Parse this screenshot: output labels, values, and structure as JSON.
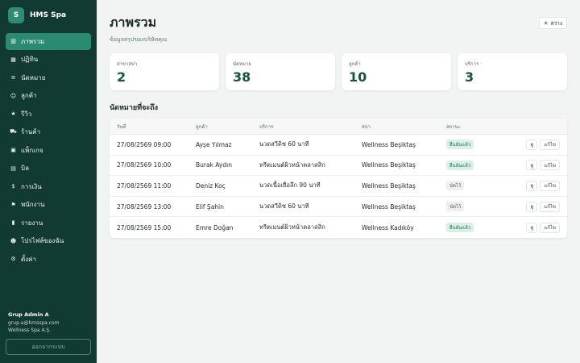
{
  "brand": {
    "logo_letter": "S",
    "name": "HMS Spa"
  },
  "sidebar": {
    "items": [
      {
        "icon": "▥",
        "label": "ภาพรวม",
        "active": true
      },
      {
        "icon": "▦",
        "label": "ปฏิทิน"
      },
      {
        "icon": "≡",
        "label": "นัดหมาย"
      },
      {
        "icon": "☺",
        "label": "ลูกค้า"
      },
      {
        "icon": "★",
        "label": "รีวิว"
      },
      {
        "icon": "⛟",
        "label": "ร้านค้า"
      },
      {
        "icon": "▣",
        "label": "แพ็กเกจ"
      },
      {
        "icon": "▤",
        "label": "บิล"
      },
      {
        "icon": "$",
        "label": "การเงิน"
      },
      {
        "icon": "⚑",
        "label": "พนักงาน"
      },
      {
        "icon": "▮",
        "label": "รายงาน"
      },
      {
        "icon": "☻",
        "label": "โปรไฟล์ของฉัน"
      },
      {
        "icon": "⚙",
        "label": "ตั้งค่า"
      }
    ],
    "user": {
      "name": "Grup Admin A",
      "email": "grup.a@hmsspa.com",
      "company": "Wellness Spa A.Ş."
    },
    "logout_label": "ออกจากระบบ"
  },
  "header": {
    "title": "ภาพรวม",
    "subtitle": "ข้อมูลสรุปของบริษัทคุณ",
    "theme_icon": "☀",
    "theme_label": "สว่าง"
  },
  "stats": [
    {
      "label": "สาขาสปา",
      "value": "2"
    },
    {
      "label": "นัดหมาย",
      "value": "38"
    },
    {
      "label": "ลูกค้า",
      "value": "10"
    },
    {
      "label": "บริการ",
      "value": "3"
    }
  ],
  "appointments": {
    "title": "นัดหมายที่จะถึง",
    "columns": {
      "date": "วันที่",
      "customer": "ลูกค้า",
      "service": "บริการ",
      "spa": "สปา",
      "status": "สถานะ"
    },
    "view_label": "ดู",
    "edit_label": "แก้ไข",
    "rows": [
      {
        "date": "27/08/2569 09:00",
        "customer": "Ayşe Yılmaz",
        "service": "นวดสวีดิช 60 นาที",
        "spa": "Wellness Beşiktaş",
        "status": "ยืนยันแล้ว",
        "status_type": "confirmed"
      },
      {
        "date": "27/08/2569 10:00",
        "customer": "Burak Aydın",
        "service": "ทรีตเมนต์ผิวหน้าคลาสสิก",
        "spa": "Wellness Beşiktaş",
        "status": "ยืนยันแล้ว",
        "status_type": "confirmed"
      },
      {
        "date": "27/08/2569 11:00",
        "customer": "Deniz Koç",
        "service": "นวดเนื้อเยื่อลึก 90 นาที",
        "spa": "Wellness Beşiktaş",
        "status": "นัดไว้",
        "status_type": "pending"
      },
      {
        "date": "27/08/2569 13:00",
        "customer": "Elif Şahin",
        "service": "นวดสวีดิช 60 นาที",
        "spa": "Wellness Beşiktaş",
        "status": "นัดไว้",
        "status_type": "pending"
      },
      {
        "date": "27/08/2569 15:00",
        "customer": "Emre Doğan",
        "service": "ทรีตเมนต์ผิวหน้าคลาสสิก",
        "spa": "Wellness Kadıköy",
        "status": "ยืนยันแล้ว",
        "status_type": "confirmed"
      }
    ]
  },
  "colors": {
    "sidebar_bg": "#113a32",
    "accent": "#2a8a72",
    "stat_value": "#15543f"
  }
}
